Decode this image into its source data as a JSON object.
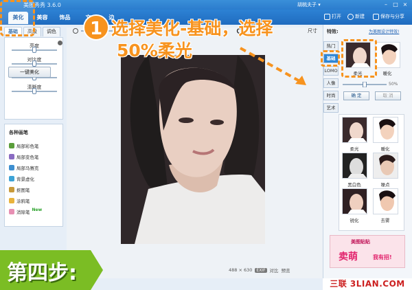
{
  "window": {
    "title": "美图秀秀 3.6.0",
    "user": "胡桃夫子 ▾"
  },
  "toolbar": {
    "tabs": [
      "美化",
      "美容",
      "饰品",
      "文",
      "边"
    ],
    "open": "打开",
    "new": "新建",
    "save": "保存与分享"
  },
  "left": {
    "subtabs": [
      "基础",
      "高级",
      "调色"
    ],
    "sliders": [
      {
        "label": "亮度",
        "value": 0.5
      },
      {
        "label": "对比度",
        "value": 0.5
      },
      {
        "label": "色彩饱和度",
        "value": 0.5
      },
      {
        "label": "清晰度",
        "value": 0.5
      }
    ],
    "one_click": "一键美化",
    "brush_title": "各种画笔",
    "brushes": [
      {
        "label": "局部彩色笔",
        "color": "#5a9e3a"
      },
      {
        "label": "局部变色笔",
        "color": "#8a6bc2"
      },
      {
        "label": "局部马赛克",
        "color": "#3d8fd0"
      },
      {
        "label": "背景虚化",
        "color": "#3ca3d6"
      },
      {
        "label": "抠图笔",
        "color": "#c89a3a"
      },
      {
        "label": "涂鸦笔",
        "color": "#e9b33c"
      },
      {
        "label": "消除笔",
        "color": "#e78fb3"
      }
    ],
    "new_badge": "New"
  },
  "canvas": {
    "size_text": "488 × 630",
    "exif": "EXIF",
    "compare": "对比",
    "preview": "预览",
    "size_right": "尺寸"
  },
  "right": {
    "label": "特效:",
    "link": "为美图设计特效!",
    "categories": [
      "热门",
      "基础",
      "LOMO",
      "人像",
      "时尚",
      "艺术"
    ],
    "top_effects": [
      "柔光",
      "暖化"
    ],
    "strength_value": 0.5,
    "strength_text": "50%",
    "confirm": "确 定",
    "cancel": "取 消",
    "grid": [
      "柔光",
      "暖化",
      "黑白色",
      "噪点",
      "锐化",
      "去雾"
    ]
  },
  "overlay": {
    "step_number": "1",
    "line1": "选择美化-基础，选择",
    "line2": "50%柔光",
    "step_banner": "第四步:",
    "watermark": "三联 3LIAN.COM"
  },
  "ad": {
    "brand": "美图贴贴",
    "main": "卖萌",
    "sub": "我有招!"
  },
  "colors": {
    "accent": "#f7931e",
    "toolbar": "#2d82d4",
    "banner": "#7bbd24"
  }
}
